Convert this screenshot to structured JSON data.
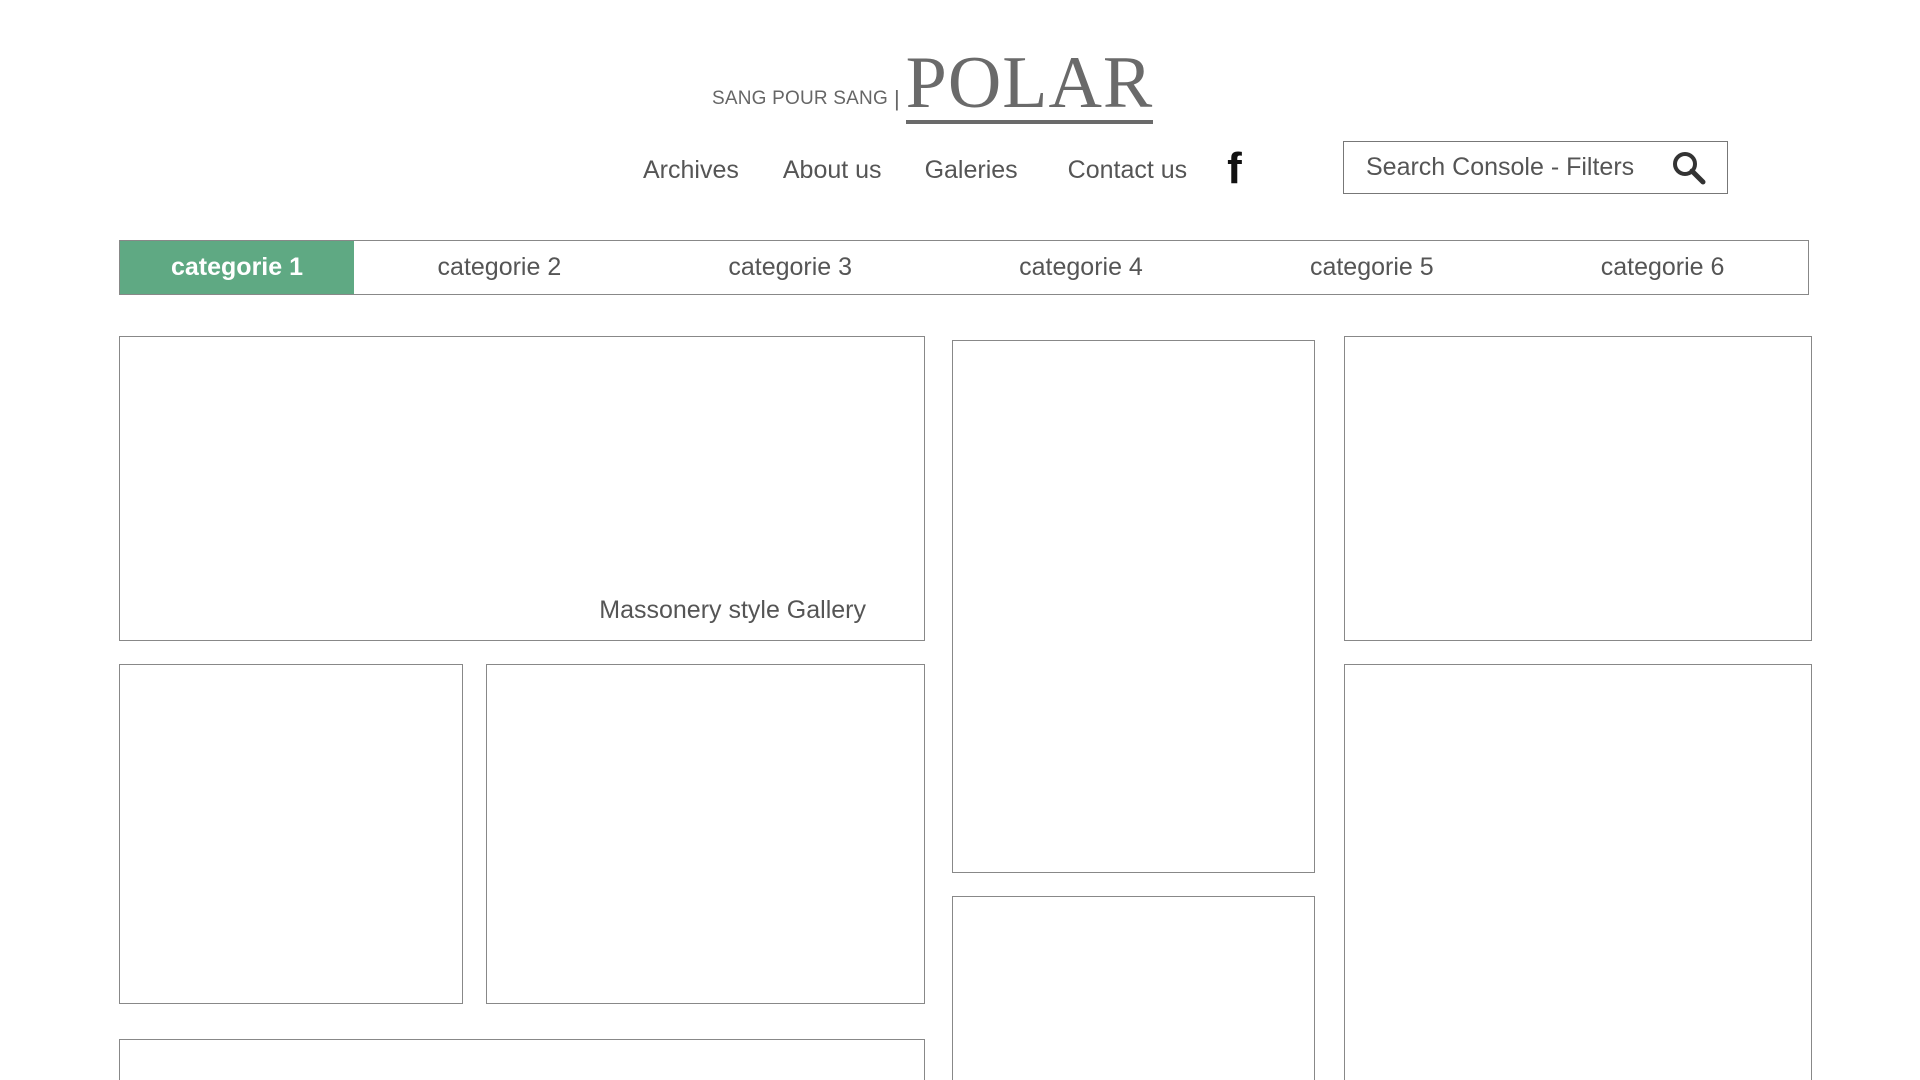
{
  "logo": {
    "tagline": "SANG POUR SANG",
    "separator": "|",
    "main": "POLAR"
  },
  "nav": {
    "items": [
      "Archives",
      "About us",
      "Galeries",
      "Contact us"
    ],
    "social_icon": "facebook-icon",
    "social_glyph": "f"
  },
  "search": {
    "text": "Search Console - Filters",
    "icon": "search-icon"
  },
  "categories": {
    "active": "categorie 1",
    "items": [
      "categorie 2",
      "categorie 3",
      "categorie 4",
      "categorie 5",
      "categorie 6"
    ],
    "active_color": "#5fa983"
  },
  "gallery": {
    "caption": "Massonery style Gallery"
  }
}
